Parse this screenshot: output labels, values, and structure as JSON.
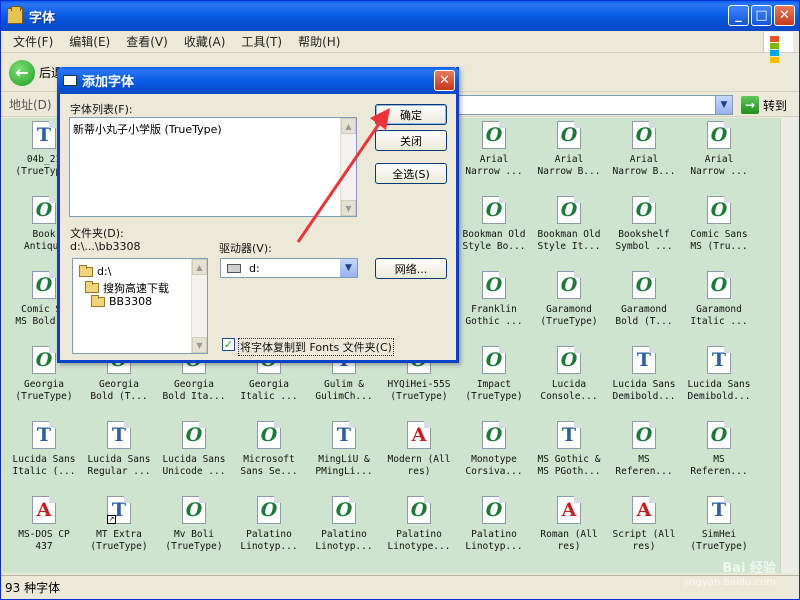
{
  "window": {
    "title": "字体"
  },
  "menu": [
    "文件(F)",
    "编辑(E)",
    "查看(V)",
    "收藏(A)",
    "工具(T)",
    "帮助(H)"
  ],
  "toolbar": {
    "back_label": "后退"
  },
  "address": {
    "label": "地址(D)",
    "go_label": "转到"
  },
  "status": {
    "text": "93 种字体"
  },
  "fonts": [
    {
      "label": "04b_21\n(TrueType)",
      "icon": "t"
    },
    {
      "label": "Book\nAntiqua",
      "icon": "o"
    },
    {
      "label": "Comic Sa\nMS Bold...",
      "icon": "o"
    },
    {
      "label": "Arial\nNarrow ...",
      "icon": "o"
    },
    {
      "label": "Arial\nNarrow B...",
      "icon": "o"
    },
    {
      "label": "Arial\nNarrow B...",
      "icon": "o"
    },
    {
      "label": "Arial\nNarrow ...",
      "icon": "o"
    },
    {
      "label": "Bookman Old\nStyle Bo...",
      "icon": "o"
    },
    {
      "label": "Bookman Old\nStyle It...",
      "icon": "o"
    },
    {
      "label": "Bookshelf\nSymbol ...",
      "icon": "o"
    },
    {
      "label": "Comic Sans\nMS (Tru...",
      "icon": "o"
    },
    {
      "label": "Franklin\nGothic ...",
      "icon": "o"
    },
    {
      "label": "Garamond\n(TrueType)",
      "icon": "o"
    },
    {
      "label": "Garamond\nBold (T...",
      "icon": "o"
    },
    {
      "label": "Garamond\nItalic ...",
      "icon": "o"
    },
    {
      "label": "Georgia\n(TrueType)",
      "icon": "o"
    },
    {
      "label": "Georgia\nBold (T...",
      "icon": "o"
    },
    {
      "label": "Georgia\nBold Ita...",
      "icon": "o"
    },
    {
      "label": "Georgia\nItalic ...",
      "icon": "o"
    },
    {
      "label": "Gulim &\nGulimCh...",
      "icon": "t"
    },
    {
      "label": "HYQiHei-55S\n(TrueType)",
      "icon": "o"
    },
    {
      "label": "Impact\n(TrueType)",
      "icon": "o"
    },
    {
      "label": "Lucida\nConsole...",
      "icon": "o"
    },
    {
      "label": "Lucida Sans\nDemibold...",
      "icon": "t"
    },
    {
      "label": "Lucida Sans\nDemibold...",
      "icon": "t"
    },
    {
      "label": "Lucida Sans\nItalic (...",
      "icon": "t"
    },
    {
      "label": "Lucida Sans\nRegular ...",
      "icon": "t"
    },
    {
      "label": "Lucida Sans\nUnicode ...",
      "icon": "o"
    },
    {
      "label": "Microsoft\nSans Se...",
      "icon": "o"
    },
    {
      "label": "MingLiU &\nPMingLi...",
      "icon": "t"
    },
    {
      "label": "Modern (All\nres)",
      "icon": "a"
    },
    {
      "label": "Monotype\nCorsiva...",
      "icon": "o"
    },
    {
      "label": "MS Gothic &\nMS PGoth...",
      "icon": "t"
    },
    {
      "label": "MS\nReferen...",
      "icon": "o"
    },
    {
      "label": "MS\nReferen...",
      "icon": "o"
    },
    {
      "label": "MS-DOS CP\n437",
      "icon": "a"
    },
    {
      "label": "MT Extra\n(TrueType)",
      "icon": "t"
    },
    {
      "label": "Mv Boli\n(TrueType)",
      "icon": "o"
    },
    {
      "label": "Palatino\nLinotyp...",
      "icon": "o"
    },
    {
      "label": "Palatino\nLinotyp...",
      "icon": "o"
    },
    {
      "label": "Palatino\nLinotype...",
      "icon": "o"
    },
    {
      "label": "Palatino\nLinotyp...",
      "icon": "o"
    },
    {
      "label": "Roman (All\nres)",
      "icon": "a"
    },
    {
      "label": "Script (All\nres)",
      "icon": "a"
    },
    {
      "label": "SimHei\n(TrueType)",
      "icon": "t"
    }
  ],
  "dialog": {
    "title": "添加字体",
    "font_list_label": "字体列表(F):",
    "font_list_item": "新蒂小丸子小学版 (TrueType)",
    "ok_label": "确定",
    "close_label": "关闭",
    "select_all_label": "全选(S)",
    "folder_label": "文件夹(D):",
    "folder_path": "d:\\...\\bb3308",
    "drive_label": "驱动器(V):",
    "drive_value": "d:",
    "network_label": "网络...",
    "tree": [
      "d:\\",
      "搜狗高速下载",
      "BB3308"
    ],
    "copy_checkbox_label": "将字体复制到 Fonts 文件夹(C)",
    "copy_checked": true
  },
  "watermark": {
    "line1": "Bai 经验",
    "line2": "jingyan.baidu.com"
  }
}
